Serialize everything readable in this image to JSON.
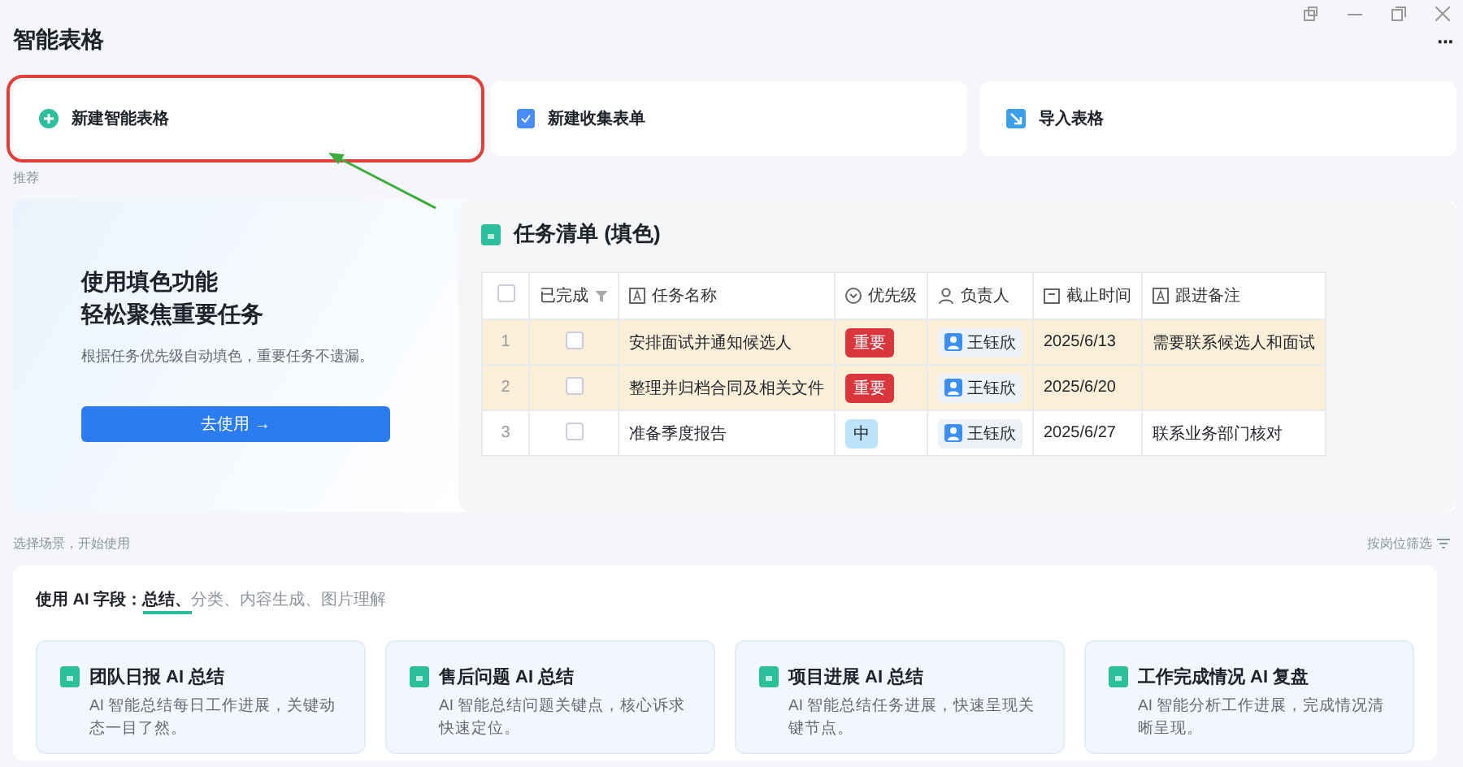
{
  "page": {
    "title": "智能表格",
    "more": "···"
  },
  "actions": [
    {
      "label": "新建智能表格",
      "kind": "create",
      "highlighted": true
    },
    {
      "label": "新建收集表单",
      "kind": "form",
      "highlighted": false
    },
    {
      "label": "导入表格",
      "kind": "import",
      "highlighted": false
    }
  ],
  "recommend_label": "推荐",
  "banner": {
    "title_lines": [
      "使用填色功能",
      "轻松聚焦重要任务"
    ],
    "description": "根据任务优先级自动填色，重要任务不遗漏。",
    "button": "去使用 →"
  },
  "preview": {
    "title": "任务清单 (填色)",
    "all_selected": false,
    "columns": [
      {
        "label": "已完成",
        "kind": "check"
      },
      {
        "label": "任务名称",
        "kind": "text"
      },
      {
        "label": "优先级",
        "kind": "select"
      },
      {
        "label": "负责人",
        "kind": "person"
      },
      {
        "label": "截止时间",
        "kind": "date"
      },
      {
        "label": "跟进备注",
        "kind": "text"
      }
    ],
    "rows": [
      {
        "index": "1",
        "done": false,
        "filled": true,
        "task": "安排面试并通知候选人",
        "priority": {
          "label": "重要",
          "color": "#d9363e"
        },
        "owner": "王钰欣",
        "due": "2025/6/13",
        "note": "需要联系候选人和面试"
      },
      {
        "index": "2",
        "done": false,
        "filled": true,
        "task": "整理并归档合同及相关文件",
        "priority": {
          "label": "重要",
          "color": "#d9363e"
        },
        "owner": "王钰欣",
        "due": "2025/6/20"
      },
      {
        "index": "3",
        "done": false,
        "filled": false,
        "task": "准备季度报告",
        "priority": {
          "label": "中",
          "color": "#bde3fb"
        },
        "owner": "王钰欣",
        "due": "2025/6/27",
        "note": "联系业务部门核对"
      }
    ]
  },
  "scenes": {
    "label": "选择场景，开始使用",
    "filter": "按岗位筛选",
    "ai_fields": {
      "prefix": "使用 AI 字段：",
      "items": [
        {
          "label": "总结、",
          "selected": true
        },
        {
          "label": "分类、",
          "selected": false
        },
        {
          "label": "内容生成、",
          "selected": false
        },
        {
          "label": "图片理解",
          "selected": false
        }
      ]
    },
    "cards": [
      {
        "title": "团队日报 AI 总结",
        "description": "AI 智能总结每日工作进展，关键动态一目了然。"
      },
      {
        "title": "售后问题 AI 总结",
        "description": "AI 智能总结问题关键点，核心诉求快速定位。"
      },
      {
        "title": "项目进展 AI 总结",
        "description": "AI 智能总结任务进展，快速呈现关键节点。"
      },
      {
        "title": "工作完成情况 AI 复盘",
        "description": "AI 智能分析工作进展，完成情况清晰呈现。"
      }
    ]
  }
}
